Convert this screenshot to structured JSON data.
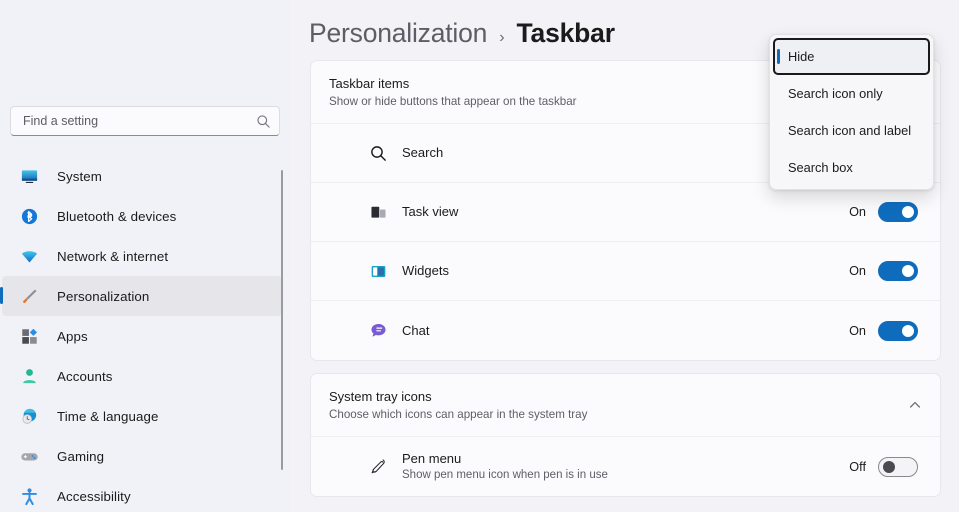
{
  "colors": {
    "accent": "#0f6cbd",
    "page_bg": "#f3f3f7",
    "sidebar_bg": "#f0f2f8",
    "card_bg": "#fbfbfd",
    "toggle_on": "#0f6cbd",
    "selected_nav_bg": "#e6e6ea"
  },
  "sidebar": {
    "search": {
      "placeholder": "Find a setting",
      "value": "",
      "icon": "search-icon"
    },
    "items": [
      {
        "label": "System",
        "icon": "system-monitor-icon",
        "selected": false
      },
      {
        "label": "Bluetooth & devices",
        "icon": "bluetooth-icon",
        "selected": false
      },
      {
        "label": "Network & internet",
        "icon": "wifi-icon",
        "selected": false
      },
      {
        "label": "Personalization",
        "icon": "paintbrush-icon",
        "selected": true
      },
      {
        "label": "Apps",
        "icon": "apps-grid-icon",
        "selected": false
      },
      {
        "label": "Accounts",
        "icon": "person-icon",
        "selected": false
      },
      {
        "label": "Time & language",
        "icon": "clock-globe-icon",
        "selected": false
      },
      {
        "label": "Gaming",
        "icon": "gamepad-icon",
        "selected": false
      },
      {
        "label": "Accessibility",
        "icon": "accessibility-icon",
        "selected": false
      }
    ]
  },
  "header": {
    "parent": "Personalization",
    "separator": "›",
    "current": "Taskbar"
  },
  "cards": [
    {
      "title": "Taskbar items",
      "subtitle": "Show or hide buttons that appear on the taskbar",
      "chevron": "",
      "rows": [
        {
          "title": "Search",
          "subtitle": "",
          "icon": "search-icon",
          "control": "dropdown",
          "state": ""
        },
        {
          "title": "Task view",
          "subtitle": "",
          "icon": "task-view-icon",
          "control": "toggle",
          "state": "On"
        },
        {
          "title": "Widgets",
          "subtitle": "",
          "icon": "widgets-icon",
          "control": "toggle",
          "state": "On"
        },
        {
          "title": "Chat",
          "subtitle": "",
          "icon": "chat-icon",
          "control": "toggle",
          "state": "On"
        }
      ]
    },
    {
      "title": "System tray icons",
      "subtitle": "Choose which icons can appear in the system tray",
      "chevron": "chevron-up-icon",
      "rows": [
        {
          "title": "Pen menu",
          "subtitle": "Show pen menu icon when pen is in use",
          "icon": "pen-icon",
          "control": "toggle",
          "state": "Off"
        }
      ]
    }
  ],
  "flyout": {
    "items": [
      {
        "label": "Hide",
        "selected": true
      },
      {
        "label": "Search icon only",
        "selected": false
      },
      {
        "label": "Search icon and label",
        "selected": false
      },
      {
        "label": "Search box",
        "selected": false
      }
    ]
  }
}
